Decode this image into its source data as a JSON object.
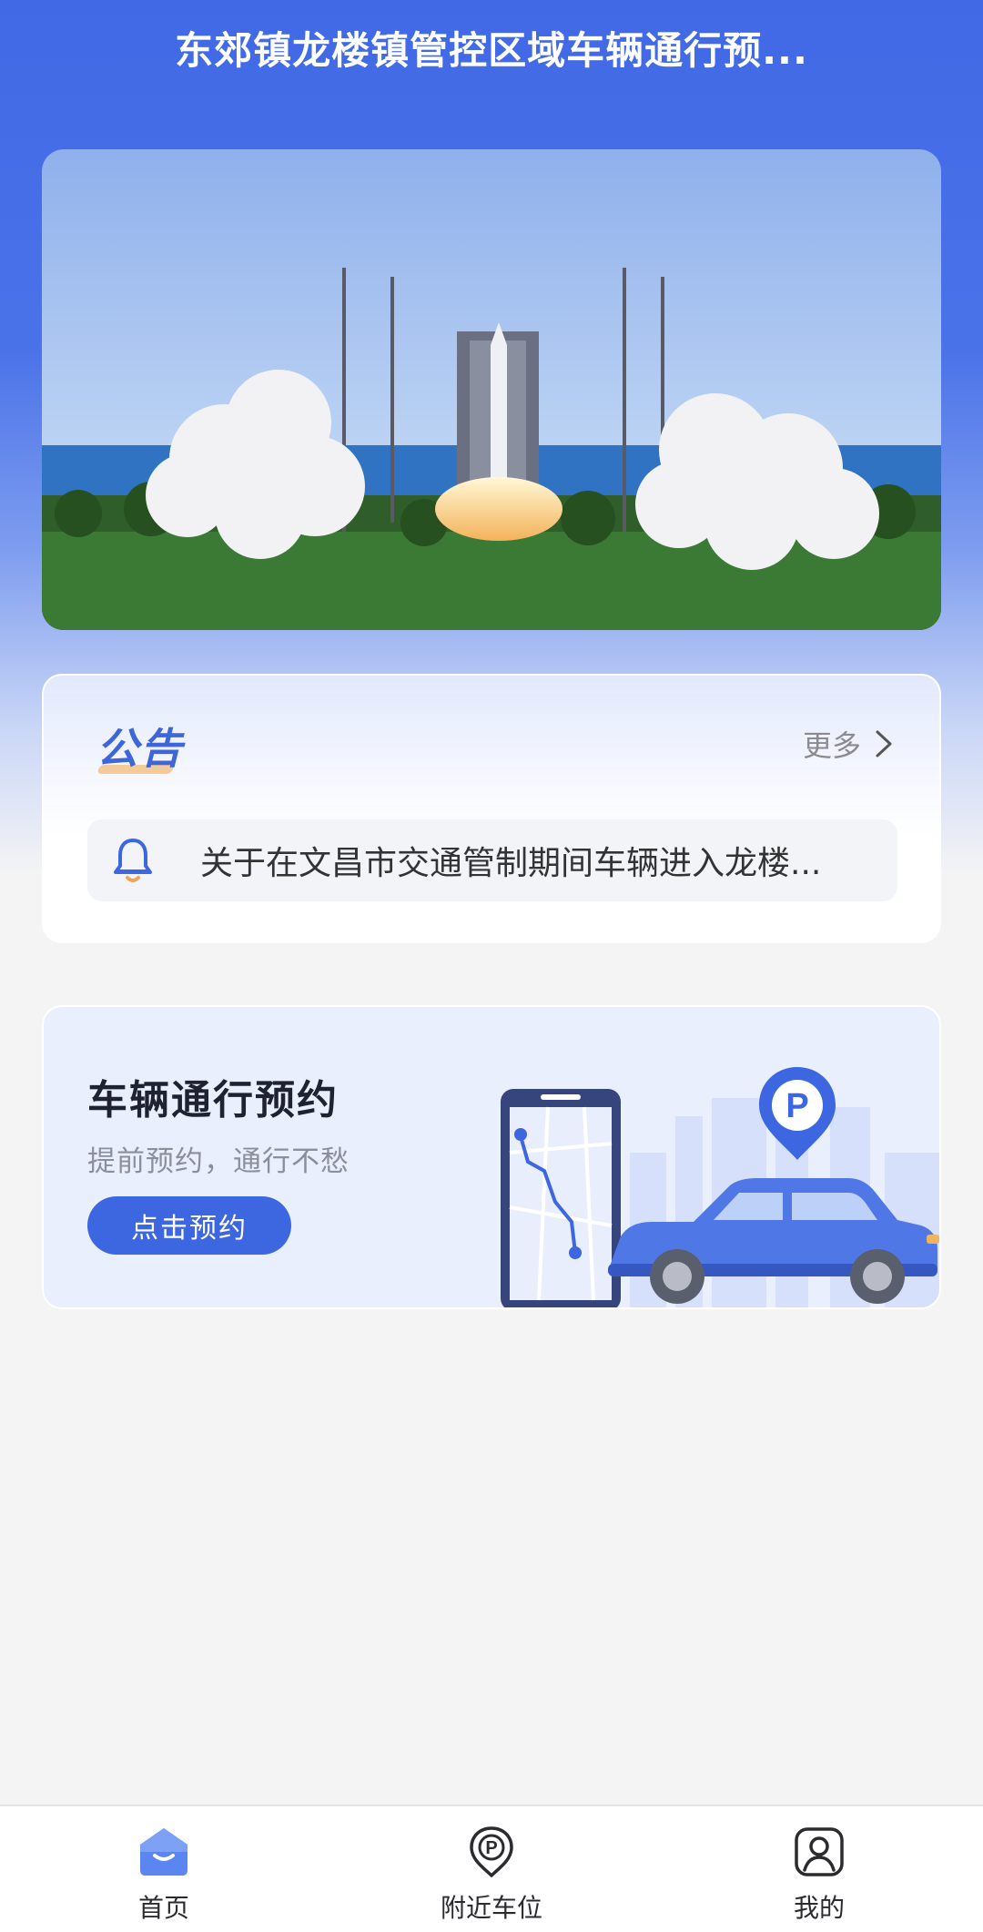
{
  "header": {
    "title": "东郊镇龙楼镇管控区域车辆通行预..."
  },
  "banner": {
    "image": "rocket-launch-photo"
  },
  "notice": {
    "title": "公告",
    "more_label": "更多",
    "item_text": "关于在文昌市交通管制期间车辆进入龙楼..."
  },
  "reservation": {
    "title": "车辆通行预约",
    "subtitle": "提前预约，通行不愁",
    "button_label": "点击预约",
    "illustration": "phone-map-car-parking-illustration"
  },
  "tabbar": {
    "items": [
      {
        "label": "首页",
        "icon": "home-icon",
        "active": true
      },
      {
        "label": "附近车位",
        "icon": "parking-pin-icon",
        "active": false
      },
      {
        "label": "我的",
        "icon": "profile-icon",
        "active": false
      }
    ]
  },
  "colors": {
    "primary": "#3d67e0",
    "header_blue": "#4169e6",
    "page_bg": "#f4f4f5"
  }
}
